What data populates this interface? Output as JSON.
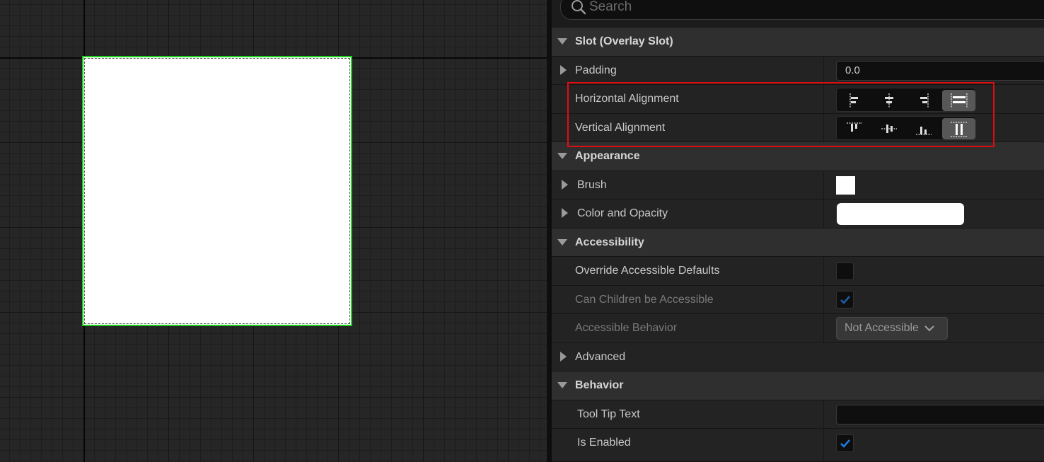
{
  "search": {
    "placeholder": "Search"
  },
  "sections": {
    "slot": {
      "title": "Slot (Overlay Slot)"
    },
    "appearance": {
      "title": "Appearance"
    },
    "accessibility": {
      "title": "Accessibility"
    },
    "advanced": {
      "title": "Advanced"
    },
    "behavior": {
      "title": "Behavior"
    }
  },
  "properties": {
    "padding": {
      "label": "Padding",
      "value": "0.0"
    },
    "horizontal_alignment": {
      "label": "Horizontal Alignment",
      "options": [
        "align-left-icon",
        "align-center-icon",
        "align-right-icon",
        "fill-horizontal-icon"
      ],
      "selected": "fill-horizontal-icon"
    },
    "vertical_alignment": {
      "label": "Vertical Alignment",
      "options": [
        "align-top-icon",
        "align-middle-icon",
        "align-bottom-icon",
        "fill-vertical-icon"
      ],
      "selected": "fill-vertical-icon"
    },
    "brush": {
      "label": "Brush",
      "color": "#FFFFFF"
    },
    "color_and_opacity": {
      "label": "Color and Opacity",
      "color": "#FFFFFF"
    },
    "override_accessible_defaults": {
      "label": "Override Accessible Defaults",
      "checked": false
    },
    "can_children_be_accessible": {
      "label": "Can Children be Accessible",
      "checked": true,
      "enabled": false
    },
    "accessible_behavior": {
      "label": "Accessible Behavior",
      "value": "Not Accessible",
      "enabled": false
    },
    "tool_tip_text": {
      "label": "Tool Tip Text",
      "value": ""
    },
    "is_enabled": {
      "label": "Is Enabled",
      "checked": true
    }
  },
  "colors": {
    "selection_outline": "#1BD11B",
    "highlight_box": "#E10D12",
    "check_accent": "#1E7BE6"
  }
}
